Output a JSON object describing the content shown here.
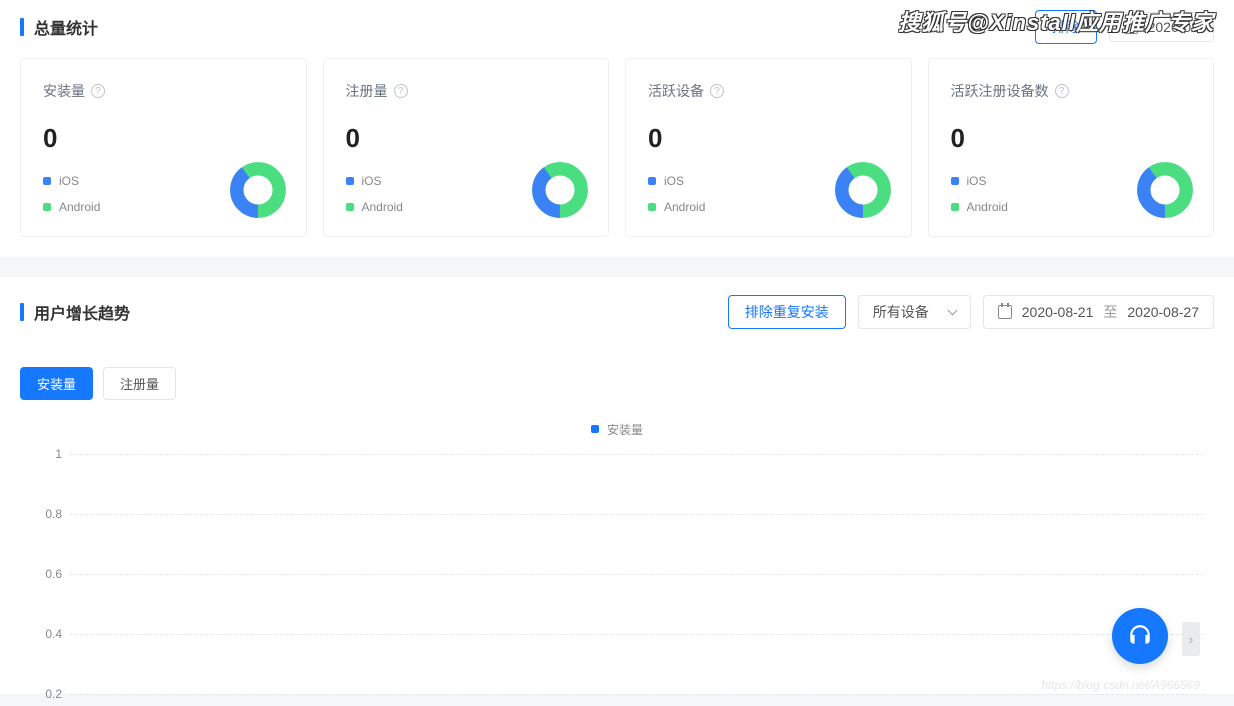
{
  "watermark": "搜狐号@Xinstall应用推广专家",
  "watermark2": "https://blog.csdn.net/A966569",
  "total_stats": {
    "title": "总量统计",
    "exclude_button": "排除",
    "date_partial": "2020-08",
    "cards": [
      {
        "title": "安装量",
        "value": "0",
        "ios_label": "iOS",
        "android_label": "Android"
      },
      {
        "title": "注册量",
        "value": "0",
        "ios_label": "iOS",
        "android_label": "Android"
      },
      {
        "title": "活跃设备",
        "value": "0",
        "ios_label": "iOS",
        "android_label": "Android"
      },
      {
        "title": "活跃注册设备数",
        "value": "0",
        "ios_label": "iOS",
        "android_label": "Android"
      }
    ]
  },
  "growth_trend": {
    "title": "用户增长趋势",
    "exclude_button": "排除重复安装",
    "device_select": "所有设备",
    "date_start": "2020-08-21",
    "date_sep": "至",
    "date_end": "2020-08-27",
    "tabs": {
      "install": "安装量",
      "register": "注册量"
    },
    "chart_legend_label": "安装量"
  },
  "chart_data": {
    "type": "line",
    "title": "",
    "xlabel": "",
    "ylabel": "",
    "ylim": [
      0,
      1
    ],
    "y_ticks": [
      1,
      0.8,
      0.6,
      0.4,
      0.2
    ],
    "categories": [],
    "series": [
      {
        "name": "安装量",
        "values": []
      }
    ]
  }
}
